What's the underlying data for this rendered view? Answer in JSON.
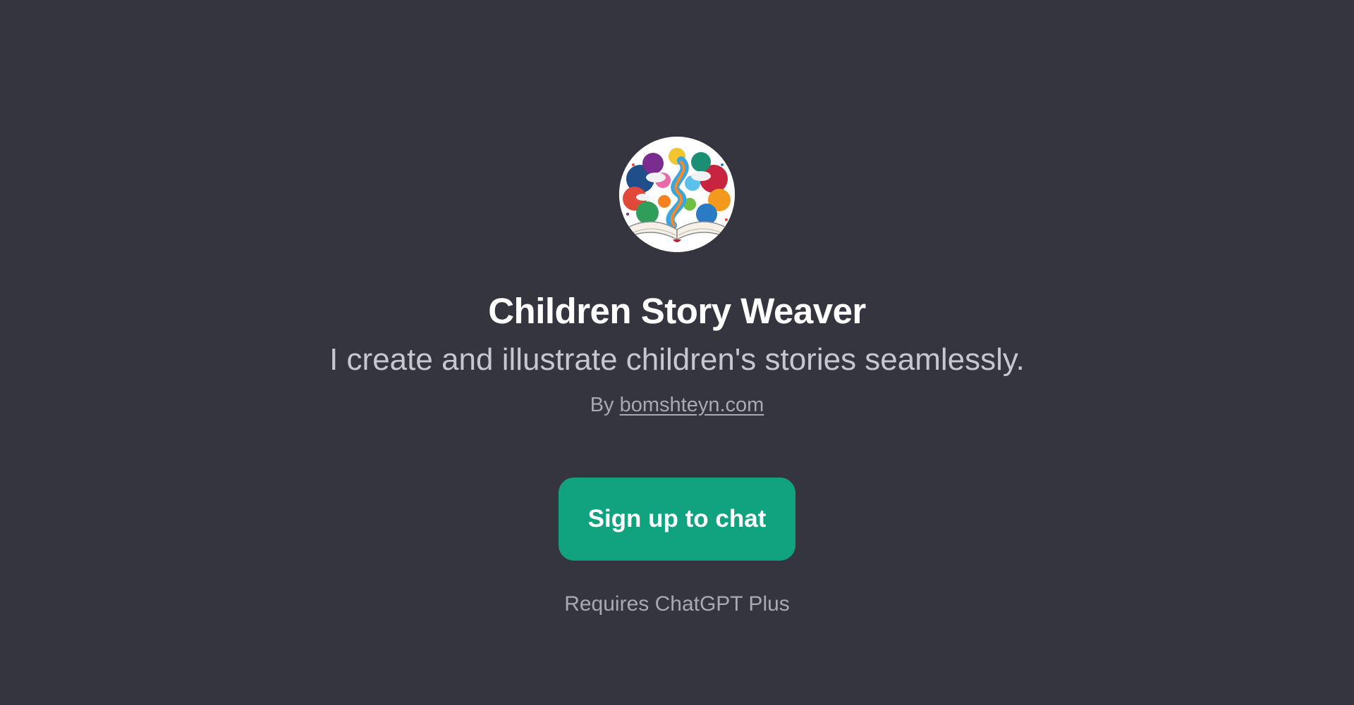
{
  "gpt": {
    "avatar_icon": "storybook-illustration",
    "title": "Children Story Weaver",
    "description": "I create and illustrate children's stories seamlessly.",
    "by_prefix": "By",
    "author_link": "bomshteyn.com"
  },
  "actions": {
    "signup_label": "Sign up to chat",
    "requirement": "Requires ChatGPT Plus"
  },
  "colors": {
    "background": "#353540",
    "accent": "#11a37f",
    "title": "#ffffff",
    "muted_text": "#a9a9b3"
  }
}
